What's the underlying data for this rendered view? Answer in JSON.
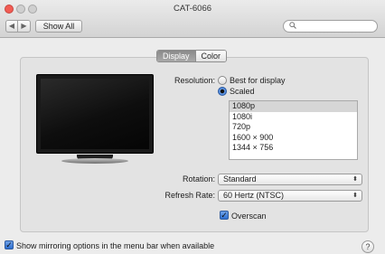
{
  "window": {
    "title": "CAT-6066"
  },
  "toolbar": {
    "back_glyph": "◀",
    "forward_glyph": "▶",
    "show_all_label": "Show All",
    "search_placeholder": "",
    "search_icon": "magnifier-icon"
  },
  "tabs": [
    {
      "label": "Display",
      "active": true
    },
    {
      "label": "Color",
      "active": false
    }
  ],
  "resolution": {
    "label": "Resolution:",
    "option_best": "Best for display",
    "option_scaled": "Scaled",
    "selected": "Scaled",
    "list": [
      "1080p",
      "1080i",
      "720p",
      "1600 × 900",
      "1344 × 756"
    ],
    "selected_row": "1080p"
  },
  "rotation": {
    "label": "Rotation:",
    "value": "Standard"
  },
  "refresh": {
    "label": "Refresh Rate:",
    "value": "60 Hertz (NTSC)"
  },
  "overscan": {
    "label": "Overscan",
    "checked": true
  },
  "mirroring": {
    "label": "Show mirroring options in the menu bar when available",
    "checked": true
  },
  "help": {
    "glyph": "?"
  },
  "colors": {
    "accent": "#2e6fd0",
    "close_button": "#f25c54"
  }
}
